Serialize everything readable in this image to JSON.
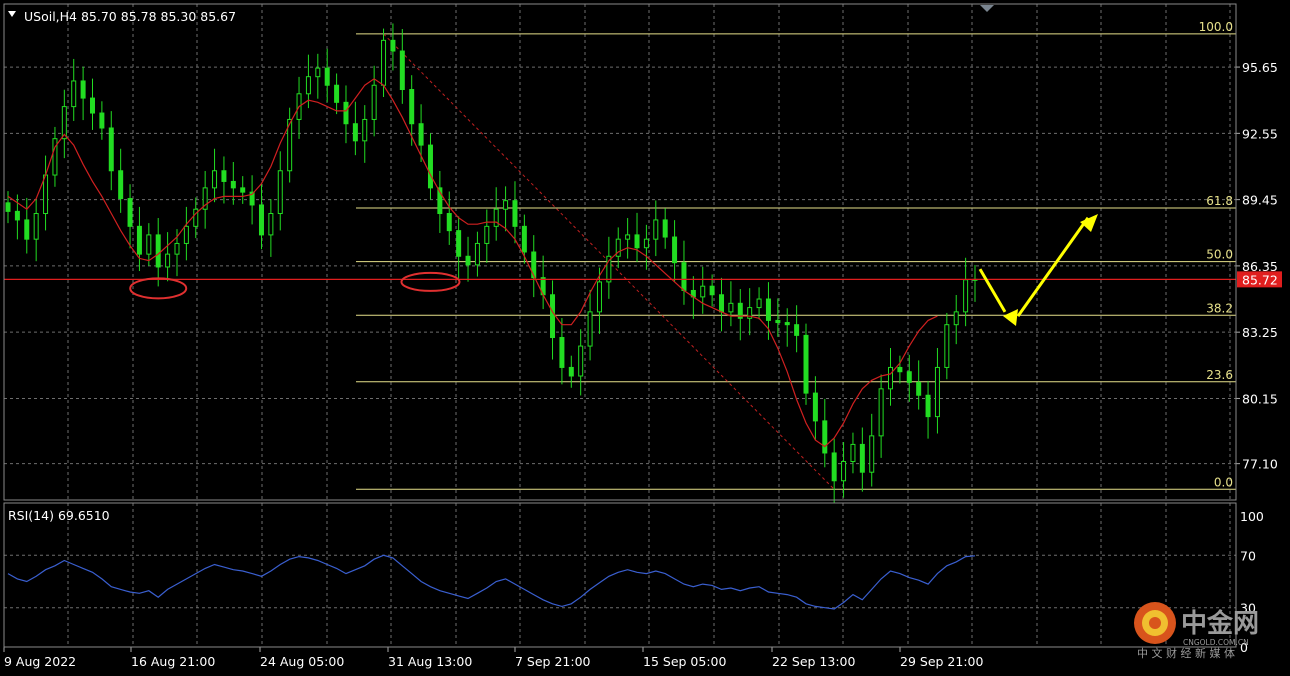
{
  "chart_data": {
    "type": "line",
    "title": "USoil,H4  85.70 85.78 85.30 85.67",
    "symbol_menu_arrow": "triangle-down-icon",
    "price_axis": {
      "ylim": [
        75.4,
        98.6
      ],
      "ticks": [
        95.65,
        92.55,
        89.45,
        86.35,
        83.25,
        80.15,
        77.1
      ],
      "tick_labels": [
        "95.65",
        "92.55",
        "89.45",
        "86.35",
        "83.25",
        "80.15",
        "77.10"
      ]
    },
    "time_axis": {
      "tick_labels": [
        "9 Aug 2022",
        "16 Aug 21:00",
        "24 Aug 05:00",
        "31 Aug 13:00",
        "7 Sep 21:00",
        "15 Sep 05:00",
        "22 Sep 13:00",
        "29 Sep 21:00"
      ]
    },
    "grid": true,
    "current_price": {
      "value": 85.72,
      "label": "85.72",
      "color": "#e01e1e"
    },
    "fibonacci": {
      "color": "#e6e08a",
      "high": 97.2,
      "low": 75.9,
      "levels": [
        {
          "ratio_label": "100.0",
          "price": 97.2
        },
        {
          "ratio_label": "61.8",
          "price": 89.06
        },
        {
          "ratio_label": "50.0",
          "price": 86.55
        },
        {
          "ratio_label": "38.2",
          "price": 84.04
        },
        {
          "ratio_label": "23.6",
          "price": 80.93
        },
        {
          "ratio_label": "0.0",
          "price": 75.9
        }
      ]
    },
    "series": [
      {
        "style": "candles",
        "color": "#22dd22",
        "close": [
          88.9,
          88.5,
          87.6,
          88.8,
          90.6,
          92.3,
          93.8,
          95.0,
          94.2,
          93.5,
          92.8,
          90.8,
          89.5,
          88.2,
          86.9,
          87.8,
          86.3,
          86.9,
          87.4,
          88.2,
          89.0,
          90.0,
          90.8,
          90.3,
          90.0,
          89.8,
          89.2,
          87.8,
          88.8,
          90.8,
          93.2,
          94.4,
          95.2,
          95.6,
          94.8,
          94.0,
          93.0,
          92.2,
          93.2,
          94.8,
          96.9,
          96.4,
          94.6,
          93.0,
          92.0,
          90.0,
          88.8,
          88.0,
          86.8,
          86.4,
          87.4,
          88.2,
          89.0,
          89.4,
          88.2,
          87.0,
          85.8,
          85.0,
          83.0,
          81.6,
          81.2,
          82.6,
          84.2,
          85.6,
          86.8,
          87.6,
          87.8,
          87.2,
          87.6,
          88.5,
          87.7,
          86.5,
          85.2,
          84.9,
          85.4,
          85.0,
          84.2,
          84.6,
          83.9,
          84.4,
          84.8,
          83.8,
          83.7,
          83.6,
          83.1,
          80.4,
          79.1,
          77.6,
          76.3,
          77.2,
          78.0,
          76.7,
          78.4,
          80.6,
          81.6,
          81.4,
          80.9,
          80.3,
          79.3,
          81.6,
          83.6,
          84.2,
          85.7,
          85.72
        ]
      },
      {
        "name": "Moving Average",
        "style": "line",
        "color": "#d02020",
        "values": [
          89.6,
          89.3,
          89.0,
          89.5,
          90.6,
          91.9,
          92.5,
          92.0,
          91.1,
          90.3,
          89.6,
          88.8,
          88.0,
          87.3,
          86.7,
          86.6,
          86.9,
          87.3,
          87.7,
          88.3,
          88.8,
          89.2,
          89.5,
          89.6,
          89.6,
          89.6,
          89.7,
          90.2,
          91.0,
          92.1,
          93.0,
          93.8,
          94.1,
          94.0,
          93.8,
          93.6,
          93.6,
          94.2,
          94.8,
          95.1,
          94.8,
          94.1,
          93.3,
          92.4,
          91.5,
          90.6,
          89.8,
          89.1,
          88.6,
          88.3,
          88.3,
          88.4,
          88.4,
          88.1,
          87.6,
          86.8,
          85.9,
          85.0,
          84.2,
          83.6,
          83.6,
          84.2,
          85.1,
          85.9,
          86.6,
          87.0,
          87.2,
          87.1,
          86.8,
          86.4,
          86.0,
          85.6,
          85.2,
          84.9,
          84.6,
          84.4,
          84.2,
          84.0,
          84.0,
          84.0,
          83.9,
          83.4,
          82.5,
          81.4,
          80.1,
          79.0,
          78.2,
          77.9,
          78.3,
          79.0,
          79.9,
          80.6,
          81.0,
          81.2,
          81.3,
          81.8,
          82.6,
          83.3,
          83.8,
          84.0
        ]
      }
    ],
    "rsi": {
      "label": "RSI(14) 69.6510",
      "ylim": [
        0,
        100
      ],
      "ticks": [
        100,
        70,
        30,
        0
      ],
      "tick_labels": [
        "100",
        "70",
        "30",
        "0"
      ],
      "color": "#3a5fd0",
      "values": [
        56,
        52,
        50,
        54,
        59,
        62,
        66,
        63,
        60,
        57,
        52,
        46,
        44,
        42,
        41,
        43,
        38,
        44,
        48,
        52,
        56,
        60,
        63,
        61,
        59,
        58,
        56,
        54,
        58,
        63,
        67,
        69,
        68,
        66,
        63,
        60,
        56,
        59,
        62,
        67,
        70,
        68,
        62,
        56,
        50,
        46,
        43,
        41,
        39,
        37,
        41,
        45,
        50,
        52,
        48,
        44,
        40,
        36,
        33,
        31,
        33,
        38,
        44,
        49,
        54,
        57,
        59,
        57,
        56,
        58,
        56,
        52,
        48,
        46,
        48,
        47,
        44,
        45,
        43,
        45,
        46,
        42,
        41,
        40,
        38,
        33,
        31,
        30,
        29,
        34,
        40,
        36,
        44,
        52,
        58,
        56,
        53,
        51,
        48,
        56,
        62,
        65,
        69,
        69.65
      ]
    },
    "annotations": {
      "support_ellipses": 2,
      "arrows_color": "#ffff00"
    }
  },
  "watermark": {
    "brand": "中金网",
    "domain": "CNGOLD.COM.CN",
    "tagline": "中 文 财 经 新 媒 体"
  }
}
